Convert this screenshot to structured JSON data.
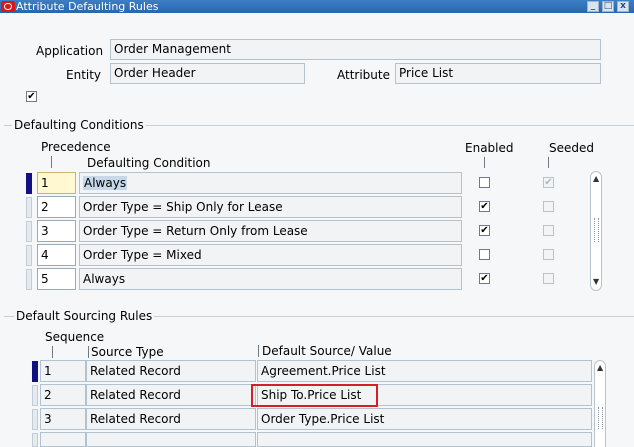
{
  "window": {
    "title": "Attribute Defaulting Rules",
    "controls": {
      "minimize": "_",
      "maximize": "□",
      "close": "x"
    }
  },
  "header": {
    "application_label": "Application",
    "application_value": "Order Management",
    "entity_label": "Entity",
    "entity_value": "Order Header",
    "attribute_label": "Attribute",
    "attribute_value": "Price List",
    "checkbox_checked": true
  },
  "defaulting_conditions": {
    "section_title": "Defaulting Conditions",
    "col_precedence": "Precedence",
    "col_condition": "Defaulting Condition",
    "col_enabled": "Enabled",
    "col_seeded": "Seeded",
    "rows": [
      {
        "precedence": "1",
        "condition": "Always",
        "enabled": false,
        "seeded": true
      },
      {
        "precedence": "2",
        "condition": "Order Type = Ship Only for Lease",
        "enabled": true,
        "seeded": false
      },
      {
        "precedence": "3",
        "condition": "Order Type = Return Only from Lease",
        "enabled": true,
        "seeded": false
      },
      {
        "precedence": "4",
        "condition": "Order Type = Mixed",
        "enabled": false,
        "seeded": false
      },
      {
        "precedence": "5",
        "condition": "Always",
        "enabled": true,
        "seeded": false
      }
    ]
  },
  "default_sourcing_rules": {
    "section_title": "Default Sourcing Rules",
    "col_sequence": "Sequence",
    "col_source_type": "Source Type",
    "col_default_source": "Default Source/ Value",
    "rows": [
      {
        "sequence": "1",
        "source_type": "Related Record",
        "default_source": "Agreement.Price List"
      },
      {
        "sequence": "2",
        "source_type": "Related Record",
        "default_source": "Ship To.Price List"
      },
      {
        "sequence": "3",
        "source_type": "Related Record",
        "default_source": "Order Type.Price List"
      },
      {
        "sequence": "",
        "source_type": "",
        "default_source": ""
      }
    ]
  },
  "colors": {
    "titlebar": "#2766ad",
    "current_record": "#101080",
    "annotation_box": "#d32026"
  },
  "icons": {
    "window_logo": "oracle-logo-icon",
    "scroll_up": "scroll-up-arrow-icon",
    "scroll_down": "scroll-down-arrow-icon"
  }
}
